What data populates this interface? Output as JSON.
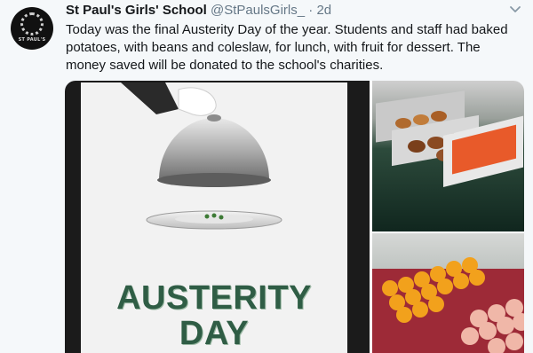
{
  "tweet": {
    "author_name": "St Paul's Girls' School",
    "handle": "@StPaulsGirls_",
    "separator": "·",
    "time": "2d",
    "avatar_text": "ST PAUL'S",
    "text": "Today was the final Austerity Day of the year. Students and staff had baked potatoes, with beans and coleslaw, for lunch, with fruit for dessert. The money saved will be donated to the school's charities."
  },
  "media": {
    "poster_line1": "AUSTERITY",
    "poster_line2": "DAY"
  },
  "icons": {
    "menu": "chevron-down-icon"
  },
  "colors": {
    "handle": "#657786",
    "poster_text": "#2f5d45"
  }
}
